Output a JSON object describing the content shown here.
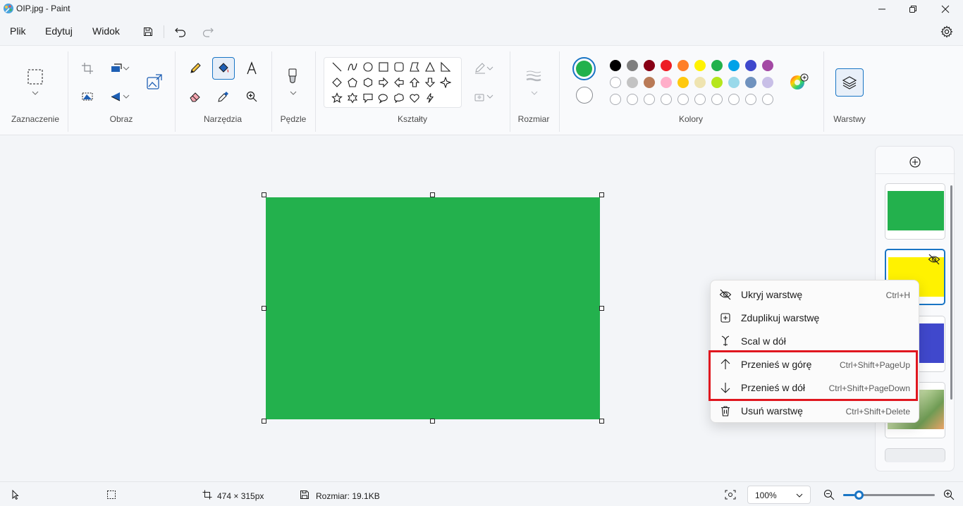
{
  "window": {
    "title": "OIP.jpg - Paint"
  },
  "menu": {
    "file": "Plik",
    "edit": "Edytuj",
    "view": "Widok"
  },
  "ribbon": {
    "groups": {
      "selection": "Zaznaczenie",
      "image": "Obraz",
      "tools": "Narzędzia",
      "brushes": "Pędzle",
      "shapes": "Kształty",
      "size": "Rozmiar",
      "colors": "Kolory",
      "layers": "Warstwy"
    },
    "colors": {
      "primary": "#22b14c",
      "secondary": "#ffffff",
      "row1": [
        "#000000",
        "#7f7f7f",
        "#880015",
        "#ed1c24",
        "#ff7f27",
        "#fff200",
        "#22b14c",
        "#00a2e8",
        "#3f48cc",
        "#a349a4"
      ],
      "row2": [
        "#ffffff",
        "#c3c3c3",
        "#b97a57",
        "#ffaec9",
        "#ffc90e",
        "#efe4b0",
        "#b5e61d",
        "#99d9ea",
        "#7092be",
        "#c8bfe7"
      ]
    }
  },
  "canvas": {
    "fill_color": "#23b14d"
  },
  "layers": [
    {
      "color": "#23b14d"
    },
    {
      "color": "#fff200",
      "hidden": true,
      "selected": true
    },
    {
      "color": "#4048cc"
    },
    {
      "color": "photo"
    }
  ],
  "context_menu": {
    "items": [
      {
        "label": "Ukryj warstwę",
        "shortcut": "Ctrl+H"
      },
      {
        "label": "Zduplikuj warstwę",
        "shortcut": ""
      },
      {
        "label": "Scal w dół",
        "shortcut": ""
      },
      {
        "label": "Przenieś w górę",
        "shortcut": "Ctrl+Shift+PageUp"
      },
      {
        "label": "Przenieś w dół",
        "shortcut": "Ctrl+Shift+PageDown"
      },
      {
        "label": "Usuń warstwę",
        "shortcut": "Ctrl+Shift+Delete"
      }
    ],
    "highlight_color": "#e0171f"
  },
  "status": {
    "canvas_size": "474 × 315px",
    "file_size": "Rozmiar: 19.1KB",
    "zoom": "100%"
  }
}
